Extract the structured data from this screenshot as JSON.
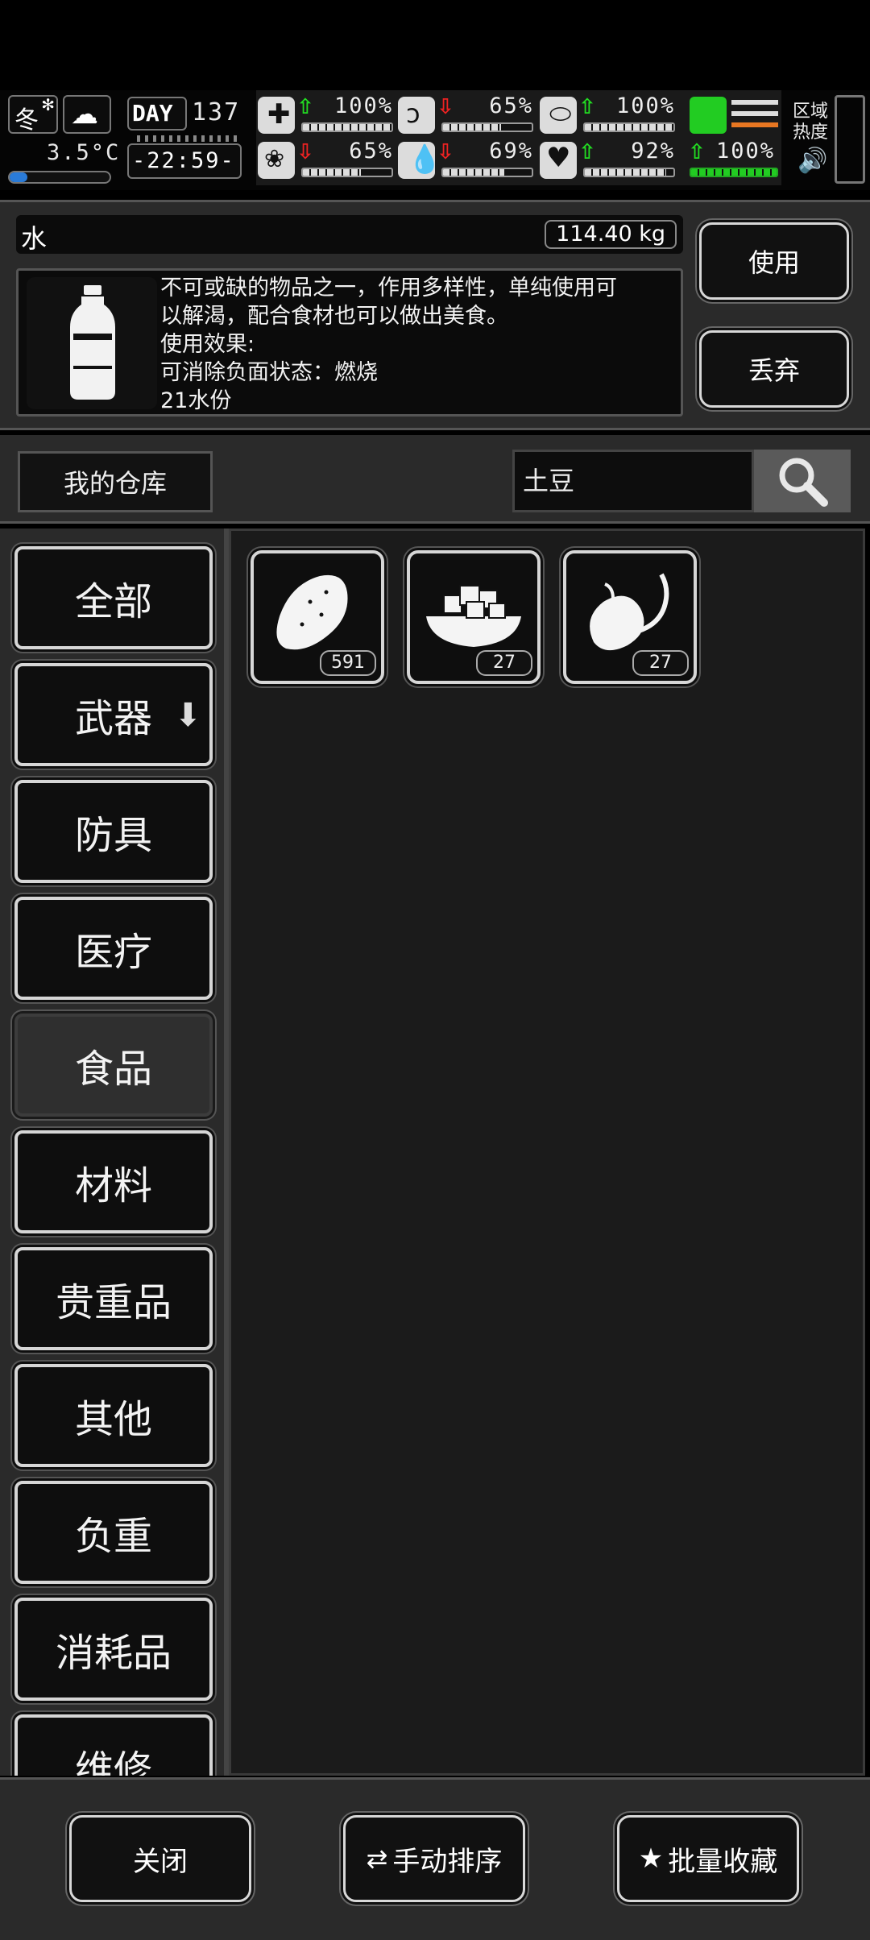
{
  "hud": {
    "season": "冬",
    "temperature": "3.5°C",
    "day_label": "DAY",
    "day_number": "137",
    "clock": "-22:59-",
    "stats": [
      {
        "name": "health",
        "icon": "medkit-icon",
        "trend": "up",
        "value": "100%",
        "level": 1.0
      },
      {
        "name": "hunger",
        "icon": "stomach-icon",
        "trend": "down",
        "value": "65%",
        "level": 0.65
      },
      {
        "name": "energy",
        "icon": "pill-icon",
        "trend": "up",
        "value": "100%",
        "level": 1.0
      },
      {
        "name": "mind",
        "icon": "brain-icon",
        "trend": "down",
        "value": "65%",
        "level": 0.65
      },
      {
        "name": "thirst",
        "icon": "water-drop-icon",
        "trend": "down",
        "value": "69%",
        "level": 0.69
      },
      {
        "name": "mood",
        "icon": "heart-icon",
        "trend": "up",
        "value": "92%",
        "level": 0.92
      }
    ],
    "stamina": {
      "trend": "up",
      "value": "100%",
      "level": 1.0
    },
    "area_heat_label": "区域\n热度"
  },
  "detail": {
    "item_name": "水",
    "weight": "114.40 kg",
    "description": "不可或缺的物品之一，作用多样性，单纯使用可\n以解渴，配合食材也可以做出美食。\n使用效果:\n可消除负面状态：燃烧\n21水份",
    "use_label": "使用",
    "drop_label": "丢弃"
  },
  "search": {
    "warehouse_label": "我的仓库",
    "query": "土豆"
  },
  "categories": [
    {
      "label": "全部",
      "active": false
    },
    {
      "label": "武器",
      "active": false,
      "has_arrow": true
    },
    {
      "label": "防具",
      "active": false
    },
    {
      "label": "医疗",
      "active": false
    },
    {
      "label": "食品",
      "active": true
    },
    {
      "label": "材料",
      "active": false
    },
    {
      "label": "贵重品",
      "active": false
    },
    {
      "label": "其他",
      "active": false
    },
    {
      "label": "负重",
      "active": false
    },
    {
      "label": "消耗品",
      "active": false
    },
    {
      "label": "维修",
      "active": false
    }
  ],
  "items": [
    {
      "icon": "potato-icon",
      "count": "591"
    },
    {
      "icon": "diced-potato-bowl-icon",
      "count": "27"
    },
    {
      "icon": "sprouted-potato-icon",
      "count": "27"
    }
  ],
  "bottom": {
    "close_label": "关闭",
    "sort_label": "手动排序",
    "favorite_label": "批量收藏"
  },
  "colors": {
    "stat_up": "#22dd22",
    "stat_down": "#ee2222",
    "panel": "#2a2a2a",
    "grid_bg": "#1b1b1b"
  }
}
